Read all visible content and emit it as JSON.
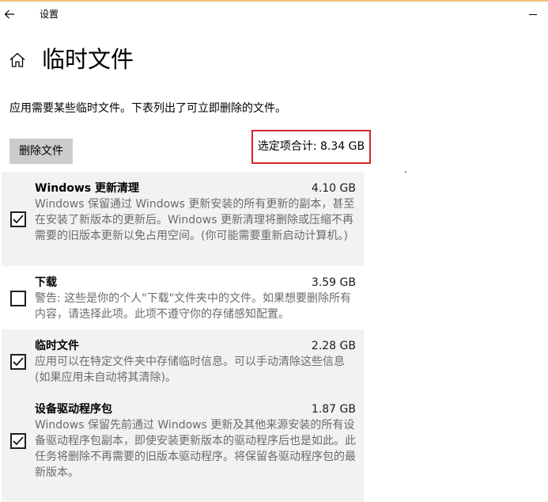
{
  "window": {
    "title": "设置"
  },
  "page": {
    "title": "临时文件",
    "description": "应用需要某些临时文件。下表列出了可立即删除的文件。"
  },
  "actions": {
    "delete_label": "删除文件",
    "selected_total": "选定项合计: 8.34 GB"
  },
  "colors": {
    "highlight_border": "#d9262c",
    "item_background": "#f2f2f2",
    "button_background": "#cccccc"
  },
  "items": [
    {
      "name": "Windows 更新清理",
      "size": "4.10 GB",
      "checked": true,
      "description": "Windows 保留通过 Windows 更新安装的所有更新的副本，甚至在安装了新版本的更新后。Windows 更新清理将删除或压缩不再需要的旧版本更新以免占用空间。(你可能需要重新启动计算机。)"
    },
    {
      "name": "下载",
      "size": "3.59 GB",
      "checked": false,
      "description": "警告: 这些是你的个人\"下载\"文件夹中的文件。如果想要删除所有内容，请选择此项。此项不遵守你的存储感知配置。"
    },
    {
      "name": "临时文件",
      "size": "2.28 GB",
      "checked": true,
      "description": "应用可以在特定文件夹中存储临时信息。可以手动清除这些信息(如果应用未自动将其清除)。"
    },
    {
      "name": "设备驱动程序包",
      "size": "1.87 GB",
      "checked": true,
      "description": "Windows 保留先前通过 Windows 更新及其他来源安装的所有设备驱动程序包副本，即使安装更新版本的驱动程序后也是如此。此任务将删除不再需要的旧版本驱动程序。将保留各驱动程序包的最新版本。"
    }
  ]
}
